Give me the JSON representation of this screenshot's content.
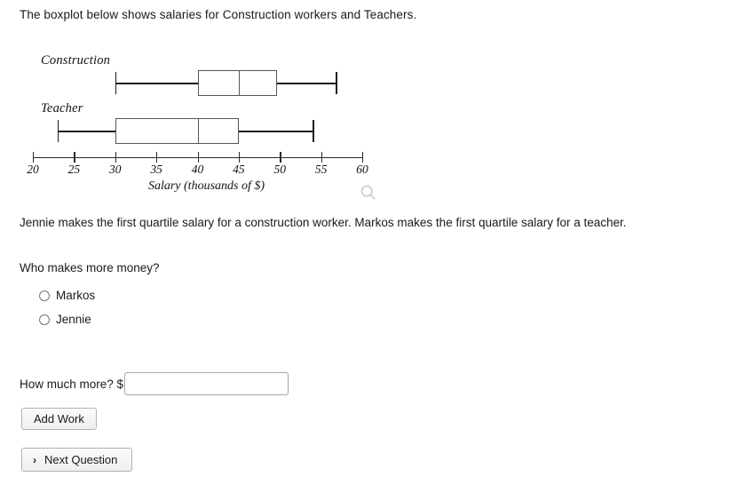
{
  "prompt": "The boxplot below shows salaries for Construction workers and Teachers.",
  "chart_data": {
    "type": "boxplot",
    "title": "",
    "xlabel": "Salary (thousands of $)",
    "ylabel": "",
    "xlim": [
      20,
      60
    ],
    "xticks": [
      20,
      25,
      30,
      35,
      40,
      45,
      50,
      55,
      60
    ],
    "xticklabels": [
      "20",
      "25",
      "30",
      "35",
      "40",
      "45",
      "50",
      "55",
      "60"
    ],
    "grid": false,
    "legend": "none",
    "series": [
      {
        "name": "Construction",
        "min": 30,
        "q1": 40,
        "median": 45,
        "q3": 49.6,
        "max": 56.8
      },
      {
        "name": "Teacher",
        "min": 23,
        "q1": 30,
        "median": 40,
        "q3": 45,
        "max": 54
      }
    ]
  },
  "magnifier_icon": "search-icon",
  "scenario": "Jennie makes the first quartile salary for a construction worker. Markos makes the first quartile salary for a teacher.",
  "question": "Who makes more money?",
  "choices": [
    {
      "label": "Markos",
      "selected": false
    },
    {
      "label": "Jennie",
      "selected": false
    }
  ],
  "how_much": {
    "label": "How much more? $",
    "value": "",
    "placeholder": ""
  },
  "buttons": {
    "add_work": "Add Work",
    "next_question": "Next Question",
    "next_chevron": "›"
  }
}
